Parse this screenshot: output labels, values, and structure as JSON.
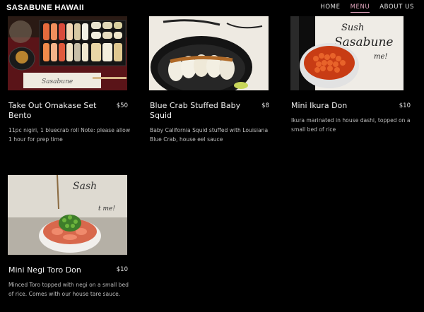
{
  "header": {
    "brand": "SASABUNE HAWAII",
    "nav": [
      {
        "label": "HOME",
        "active": false
      },
      {
        "label": "MENU",
        "active": true
      },
      {
        "label": "ABOUT US",
        "active": false
      }
    ]
  },
  "menu": {
    "items": [
      {
        "name": "Take Out Omakase Set Bento",
        "price": "$50",
        "description": "11pc nigiri, 1 bluecrab roll Note: please allow 1 hour for prep time",
        "image": "bento-photo"
      },
      {
        "name": "Blue Crab Stuffed Baby Squid",
        "price": "$8",
        "description": "Baby California Squid stuffed with Louisiana Blue Crab, house eel sauce",
        "image": "squid-photo"
      },
      {
        "name": "Mini Ikura Don",
        "price": "$10",
        "description": "Ikura marinated in house dashi, topped on a small bed of rice",
        "image": "ikura-photo"
      },
      {
        "name": "Mini Negi Toro Don",
        "price": "$10",
        "description": "Minced Toro topped with negi  on a small bed of rice. Comes with our house tare sauce.",
        "image": "toro-photo"
      }
    ]
  },
  "colors": {
    "background": "#000000",
    "accent": "#e3a6bf"
  }
}
